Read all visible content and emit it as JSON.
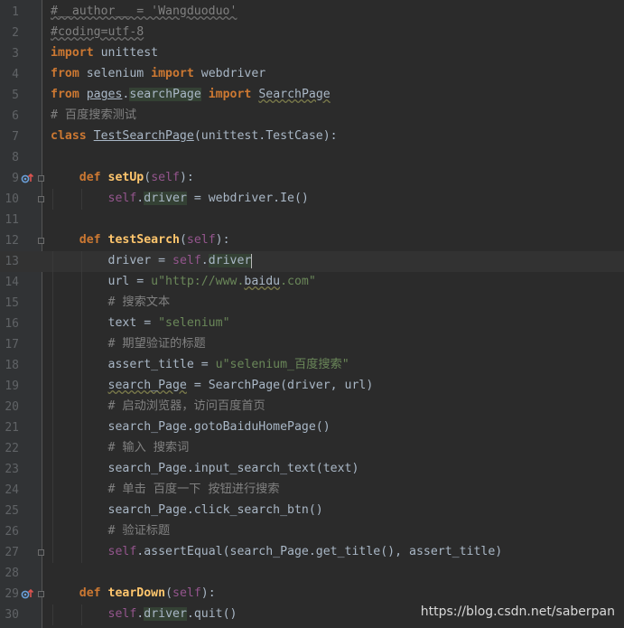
{
  "editor": {
    "language": "python",
    "current_line": 13,
    "lines": [
      {
        "n": "1",
        "tokens": [
          [
            "dunder",
            "#__author__ = 'Wangduoduo'"
          ]
        ]
      },
      {
        "n": "2",
        "tokens": [
          [
            "dunder",
            "#coding=utf-8"
          ]
        ]
      },
      {
        "n": "3",
        "tokens": [
          [
            "kw",
            "import"
          ],
          [
            "plain",
            " unittest"
          ]
        ]
      },
      {
        "n": "4",
        "tokens": [
          [
            "kw",
            "from"
          ],
          [
            "plain",
            " selenium "
          ],
          [
            "kw",
            "import"
          ],
          [
            "plain",
            " webdriver"
          ]
        ]
      },
      {
        "n": "5",
        "tokens": [
          [
            "kw",
            "from"
          ],
          [
            "plain",
            " "
          ],
          [
            "ul",
            "pages"
          ],
          [
            "plain",
            "."
          ],
          [
            "hl",
            "searchPage"
          ],
          [
            "plain",
            " "
          ],
          [
            "kw",
            "import"
          ],
          [
            "plain",
            " "
          ],
          [
            "typo",
            "SearchPage"
          ]
        ]
      },
      {
        "n": "6",
        "tokens": [
          [
            "cmt",
            "# 百度搜索测试"
          ]
        ]
      },
      {
        "n": "7",
        "tokens": [
          [
            "kw",
            "class"
          ],
          [
            "plain",
            " "
          ],
          [
            "ul",
            "TestSearchPage"
          ],
          [
            "plain",
            "(unittest.TestCase):"
          ]
        ]
      },
      {
        "n": "8",
        "tokens": []
      },
      {
        "n": "9",
        "marker": "override",
        "fold": true,
        "indent": 4,
        "tokens": [
          [
            "kw",
            "def"
          ],
          [
            "plain",
            " "
          ],
          [
            "fn",
            "setUp"
          ],
          [
            "plain",
            "("
          ],
          [
            "selfkw",
            "self"
          ],
          [
            "plain",
            "):"
          ]
        ]
      },
      {
        "n": "10",
        "fold": true,
        "indent": 8,
        "tokens": [
          [
            "selfkw",
            "self"
          ],
          [
            "plain",
            "."
          ],
          [
            "hl",
            "driver"
          ],
          [
            "plain",
            " = webdriver.Ie()"
          ]
        ]
      },
      {
        "n": "11",
        "tokens": []
      },
      {
        "n": "12",
        "fold": true,
        "indent": 4,
        "tokens": [
          [
            "kw",
            "def"
          ],
          [
            "plain",
            " "
          ],
          [
            "fn",
            "testSearch"
          ],
          [
            "plain",
            "("
          ],
          [
            "selfkw",
            "self"
          ],
          [
            "plain",
            "):"
          ]
        ]
      },
      {
        "n": "13",
        "indent": 8,
        "caret": true,
        "tokens": [
          [
            "plain",
            "driver = "
          ],
          [
            "selfkw",
            "self"
          ],
          [
            "plain",
            "."
          ],
          [
            "hl",
            "driver"
          ]
        ]
      },
      {
        "n": "14",
        "indent": 8,
        "tokens": [
          [
            "plain",
            "url = "
          ],
          [
            "str",
            "u\"http://www."
          ],
          [
            "typo",
            "baidu"
          ],
          [
            "str",
            ".com\""
          ]
        ]
      },
      {
        "n": "15",
        "indent": 8,
        "tokens": [
          [
            "cmt",
            "# 搜索文本"
          ]
        ]
      },
      {
        "n": "16",
        "indent": 8,
        "tokens": [
          [
            "plain",
            "text = "
          ],
          [
            "str",
            "\"selenium\""
          ]
        ]
      },
      {
        "n": "17",
        "indent": 8,
        "tokens": [
          [
            "cmt",
            "# 期望验证的标题"
          ]
        ]
      },
      {
        "n": "18",
        "indent": 8,
        "tokens": [
          [
            "plain",
            "assert_title = "
          ],
          [
            "str",
            "u\"selenium_百度搜索\""
          ]
        ]
      },
      {
        "n": "19",
        "indent": 8,
        "tokens": [
          [
            "typo",
            "search_Page"
          ],
          [
            "plain",
            " = SearchPage(driver, url)"
          ]
        ]
      },
      {
        "n": "20",
        "indent": 8,
        "tokens": [
          [
            "cmt",
            "# 启动浏览器，访问百度首页"
          ]
        ]
      },
      {
        "n": "21",
        "indent": 8,
        "tokens": [
          [
            "plain",
            "search_Page.gotoBaiduHomePage()"
          ]
        ]
      },
      {
        "n": "22",
        "indent": 8,
        "tokens": [
          [
            "cmt",
            "# 输入 搜索词"
          ]
        ]
      },
      {
        "n": "23",
        "indent": 8,
        "tokens": [
          [
            "plain",
            "search_Page.input_search_text(text)"
          ]
        ]
      },
      {
        "n": "24",
        "indent": 8,
        "tokens": [
          [
            "cmt",
            "# 单击 百度一下 按钮进行搜索"
          ]
        ]
      },
      {
        "n": "25",
        "indent": 8,
        "tokens": [
          [
            "plain",
            "search_Page.click_search_btn()"
          ]
        ]
      },
      {
        "n": "26",
        "indent": 8,
        "tokens": [
          [
            "cmt",
            "# 验证标题"
          ]
        ]
      },
      {
        "n": "27",
        "fold": true,
        "indent": 8,
        "tokens": [
          [
            "selfkw",
            "self"
          ],
          [
            "plain",
            ".assertEqual(search_Page.get_title(), assert_title)"
          ]
        ]
      },
      {
        "n": "28",
        "tokens": []
      },
      {
        "n": "29",
        "marker": "override",
        "fold": true,
        "indent": 4,
        "tokens": [
          [
            "kw",
            "def"
          ],
          [
            "plain",
            " "
          ],
          [
            "fn",
            "tearDown"
          ],
          [
            "plain",
            "("
          ],
          [
            "selfkw",
            "self"
          ],
          [
            "plain",
            "):"
          ]
        ]
      },
      {
        "n": "30",
        "indent": 8,
        "tokens": [
          [
            "selfkw",
            "self"
          ],
          [
            "plain",
            "."
          ],
          [
            "hl",
            "driver"
          ],
          [
            "plain",
            ".quit()"
          ]
        ]
      }
    ]
  },
  "watermark": "https://blog.csdn.net/saberpan",
  "colors": {
    "background": "#2b2b2b",
    "gutter": "#313335",
    "keyword": "#cc7832",
    "function": "#ffc66d",
    "self": "#94558d",
    "string": "#6a8759",
    "comment": "#808080",
    "text": "#a9b7c6",
    "line_number": "#606366"
  }
}
